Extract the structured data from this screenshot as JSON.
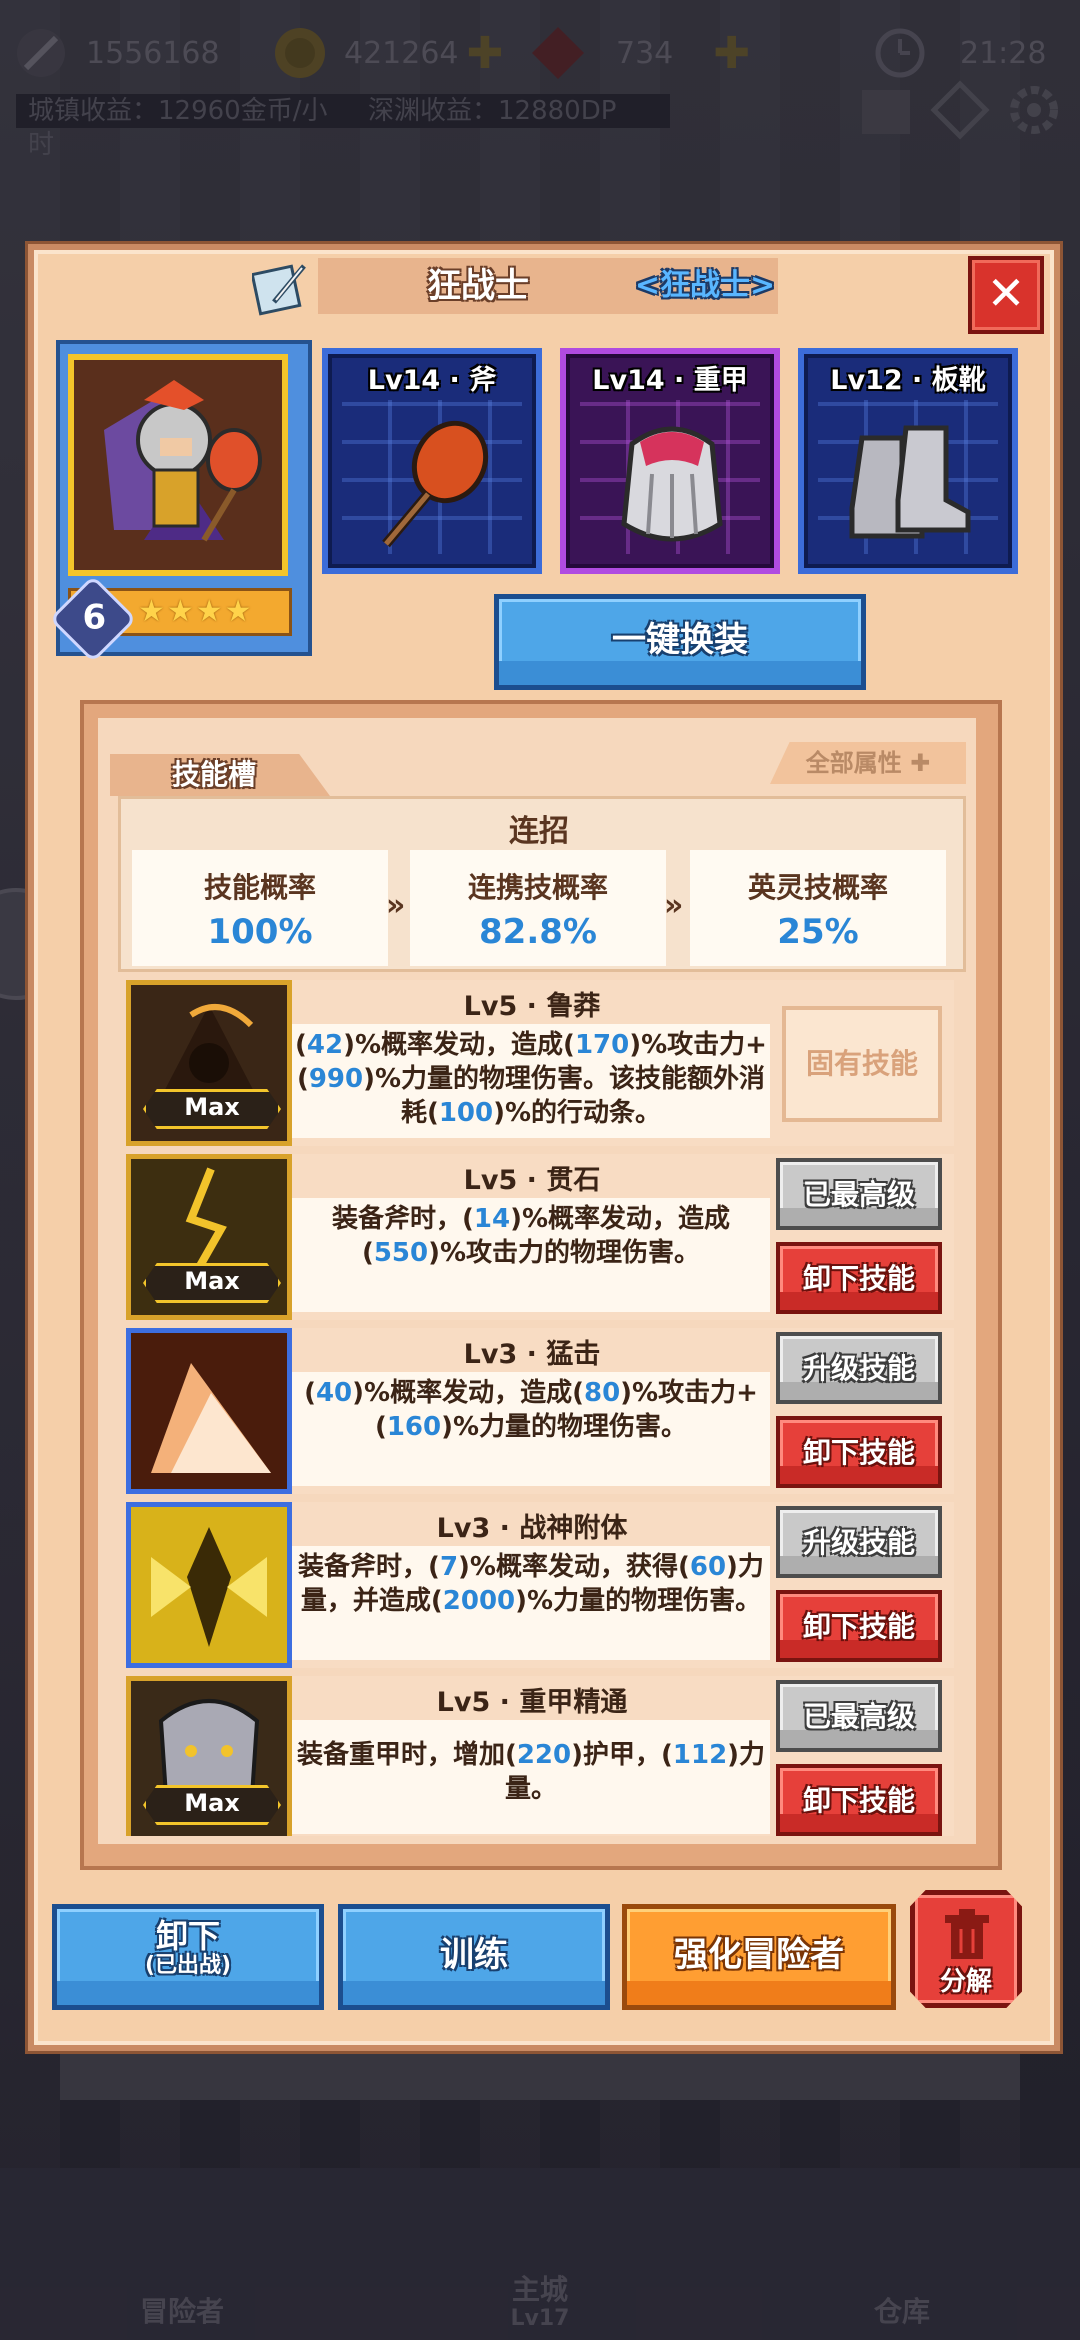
{
  "top_bar": {
    "power": "1556168",
    "gold": "421264",
    "gems": "734",
    "time": "21:28",
    "town_income": "城镇收益：12960金币/小时",
    "abyss_income": "深渊收益：12880DP"
  },
  "dialog": {
    "hero_name": "狂战士",
    "hero_class": "<狂战士>",
    "close_glyph": "✕",
    "hero_level": "6",
    "hero_stars": "★★★★",
    "equipment": [
      {
        "label": "Lv14 · 斧"
      },
      {
        "label": "Lv14 · 重甲"
      },
      {
        "label": "Lv12 · 板靴"
      }
    ],
    "one_click_equip": "一键换装"
  },
  "skills_panel": {
    "tab_label": "技能槽",
    "all_attributes": "全部属性 ✚",
    "combo_title": "连招",
    "stats": [
      {
        "label": "技能概率",
        "value": "100%"
      },
      {
        "label": "连携技概率",
        "value": "82.8%"
      },
      {
        "label": "英灵技概率",
        "value": "25%"
      }
    ],
    "chevron": "»",
    "skills": [
      {
        "name": "Lv5 · 鲁莽",
        "max": "Max",
        "desc_html": "(<span class='n'>42</span>)%概率发动，造成(<span class='n'>170</span>)%攻击力+(<span class='n'>990</span>)%力量的物理伤害。该技能额外消耗(<span class='n'>100</span>)%的行动条。",
        "button1": "固有技能",
        "button2": ""
      },
      {
        "name": "Lv5 · 贯石",
        "max": "Max",
        "desc_html": "装备斧时，(<span class='n'>14</span>)%概率发动，造成(<span class='n'>550</span>)%攻击力的物理伤害。",
        "button1": "已最高级",
        "button2": "卸下技能"
      },
      {
        "name": "Lv3 · 猛击",
        "max": "",
        "desc_html": "(<span class='n'>40</span>)%概率发动，造成(<span class='n'>80</span>)%攻击力+(<span class='n'>160</span>)%力量的物理伤害。",
        "button1": "升级技能",
        "button2": "卸下技能"
      },
      {
        "name": "Lv3 · 战神附体",
        "max": "",
        "desc_html": "装备斧时，(<span class='n'>7</span>)%概率发动，获得(<span class='n'>60</span>)力量，并造成(<span class='n'>2000</span>)%力量的物理伤害。",
        "button1": "升级技能",
        "button2": "卸下技能"
      },
      {
        "name": "Lv5 · 重甲精通",
        "max": "Max",
        "desc_html": "装备重甲时，增加(<span class='n'>220</span>)护甲，(<span class='n'>112</span>)力量。",
        "button1": "已最高级",
        "button2": "卸下技能"
      }
    ]
  },
  "bottom_buttons": {
    "unequip": "卸下",
    "unequip_sub": "(已出战)",
    "train": "训练",
    "enhance": "强化冒险者",
    "disassemble": "分解"
  },
  "nav": {
    "adventurers": "冒险者",
    "main_city": "主城",
    "main_city_level": "Lv17",
    "warehouse": "仓库"
  },
  "colors": {
    "dialog_bg": "#f5cfa9",
    "accent_blue": "#2a86d6",
    "button_red": "#e6403a",
    "button_orange": "#ff9e32"
  }
}
